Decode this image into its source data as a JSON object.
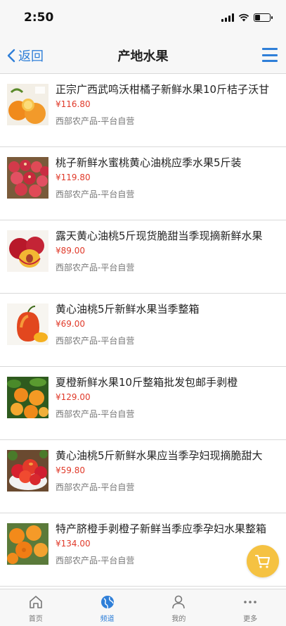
{
  "status_bar": {
    "time": "2:50"
  },
  "nav": {
    "back_label": "返回",
    "title": "产地水果"
  },
  "products": [
    {
      "title": "正宗广西武鸣沃柑橘子新鲜水果10斤桔子沃甘",
      "price": "¥116.80",
      "shop": "西部农产品-平台自营",
      "image": "mandarin-oranges"
    },
    {
      "title": "桃子新鲜水蜜桃黄心油桃应季水果5斤装",
      "price": "¥119.80",
      "shop": "西部农产品-平台自营",
      "image": "peaches-basket"
    },
    {
      "title": "露天黄心油桃5斤现货脆甜当季现摘新鲜水果",
      "price": "¥89.00",
      "shop": "西部农产品-平台自营",
      "image": "nectarine-halves"
    },
    {
      "title": "黄心油桃5斤新鲜水果当季整箱",
      "price": "¥69.00",
      "shop": "西部农产品-平台自营",
      "image": "nectarine-single"
    },
    {
      "title": "夏橙新鲜水果10斤整箱批发包邮手剥橙",
      "price": "¥129.00",
      "shop": "西部农产品-平台自营",
      "image": "oranges-tree"
    },
    {
      "title": "黄心油桃5斤新鲜水果应当季孕妇现摘脆甜大",
      "price": "¥59.80",
      "shop": "西部农产品-平台自营",
      "image": "nectarines-bowl"
    },
    {
      "title": "特产脐橙手剥橙子新鲜当季应季孕妇水果整箱",
      "price": "¥134.00",
      "shop": "西部农产品-平台自营",
      "image": "navel-oranges"
    }
  ],
  "tabs": [
    {
      "label": "首页",
      "icon": "home-icon",
      "active": false
    },
    {
      "label": "频道",
      "icon": "globe-icon",
      "active": true
    },
    {
      "label": "我的",
      "icon": "user-icon",
      "active": false
    },
    {
      "label": "更多",
      "icon": "more-icon",
      "active": false
    }
  ],
  "colors": {
    "accent": "#2f7fd8",
    "price": "#e03a2a",
    "fab": "#f5c242"
  }
}
